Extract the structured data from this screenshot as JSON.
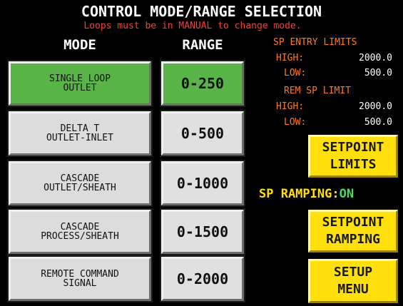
{
  "header": {
    "title": "CONTROL MODE/RANGE SELECTION",
    "warning": "Loops must be in MANUAL to change mode."
  },
  "columns": {
    "mode": "MODE",
    "range": "RANGE"
  },
  "modes": [
    {
      "line1": "SINGLE LOOP",
      "line2": "OUTLET",
      "selected": true
    },
    {
      "line1": "DELTA T",
      "line2": "OUTLET-INLET",
      "selected": false
    },
    {
      "line1": "CASCADE",
      "line2": "OUTLET/SHEATH",
      "selected": false
    },
    {
      "line1": "CASCADE",
      "line2": "PROCESS/SHEATH",
      "selected": false
    },
    {
      "line1": "REMOTE COMMAND",
      "line2": "SIGNAL",
      "selected": false
    }
  ],
  "ranges": [
    {
      "label": "0-250",
      "selected": true
    },
    {
      "label": "0-500",
      "selected": false
    },
    {
      "label": "0-1000",
      "selected": false
    },
    {
      "label": "0-1500",
      "selected": false
    },
    {
      "label": "0-2000",
      "selected": false
    }
  ],
  "sp_entry_limits": {
    "title": "SP ENTRY LIMITS",
    "high_label": "HIGH:",
    "high_value": "2000.0",
    "low_label": "LOW:",
    "low_value": "500.0"
  },
  "rem_sp_limit": {
    "title": "REM SP LIMIT",
    "high_label": "HIGH:",
    "high_value": "2000.0",
    "low_label": "LOW:",
    "low_value": "500.0"
  },
  "sp_ramping": {
    "label": "SP RAMPING:",
    "value": "ON"
  },
  "buttons": {
    "setpoint_limits": {
      "line1": "SETPOINT",
      "line2": "LIMITS"
    },
    "setpoint_ramping": {
      "line1": "SETPOINT",
      "line2": "RAMPING"
    },
    "setup_menu": {
      "line1": "SETUP",
      "line2": "MENU"
    }
  },
  "colors": {
    "background": "#000000",
    "selected": "#5ab548",
    "button": "#dcdcdc",
    "accent_yellow": "#ffe00a",
    "info_orange": "#ff7a1a",
    "warning_red": "#ff3b30",
    "on_green": "#4cd964"
  }
}
